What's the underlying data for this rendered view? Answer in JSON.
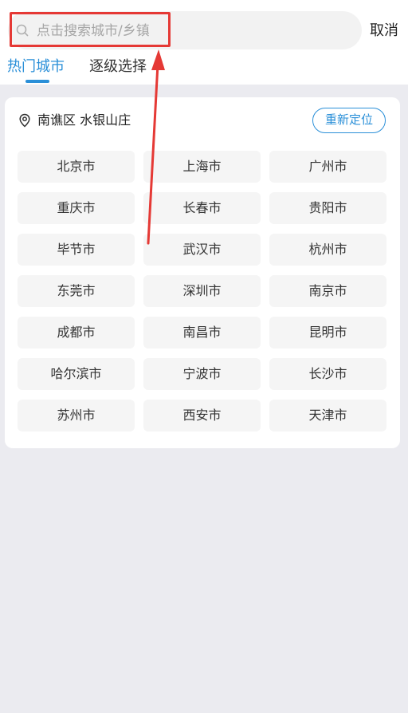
{
  "search": {
    "placeholder": "点击搜索城市/乡镇"
  },
  "header": {
    "cancel_label": "取消"
  },
  "tabs": [
    {
      "label": "热门城市",
      "active": true
    },
    {
      "label": "逐级选择",
      "active": false
    }
  ],
  "location": {
    "current": "南谯区 水银山庄",
    "relocate_label": "重新定位"
  },
  "hot_cities": [
    "北京市",
    "上海市",
    "广州市",
    "重庆市",
    "长春市",
    "贵阳市",
    "毕节市",
    "武汉市",
    "杭州市",
    "东莞市",
    "深圳市",
    "南京市",
    "成都市",
    "南昌市",
    "昆明市",
    "哈尔滨市",
    "宁波市",
    "长沙市",
    "苏州市",
    "西安市",
    "天津市"
  ],
  "colors": {
    "accent": "#2a8fd8",
    "annotation": "#e53935",
    "background": "#ebebf0"
  }
}
